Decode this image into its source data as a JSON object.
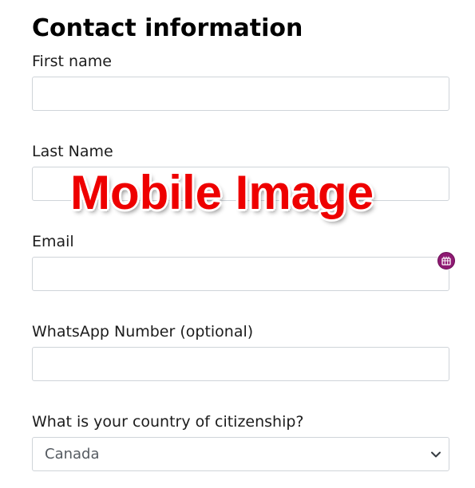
{
  "form": {
    "title": "Contact information",
    "first_name": {
      "label": "First name",
      "value": ""
    },
    "last_name": {
      "label": "Last Name",
      "value": ""
    },
    "email": {
      "label": "Email",
      "value": ""
    },
    "whatsapp": {
      "label": "WhatsApp Number (optional)",
      "value": ""
    },
    "citizenship": {
      "label": "What is your country of citizenship?",
      "selected": "Canada"
    }
  },
  "extension_badge": {
    "icon": "grid-icon",
    "color": "#8f1a73"
  },
  "watermark": {
    "text": "Mobile Image",
    "color": "#ee0000"
  }
}
